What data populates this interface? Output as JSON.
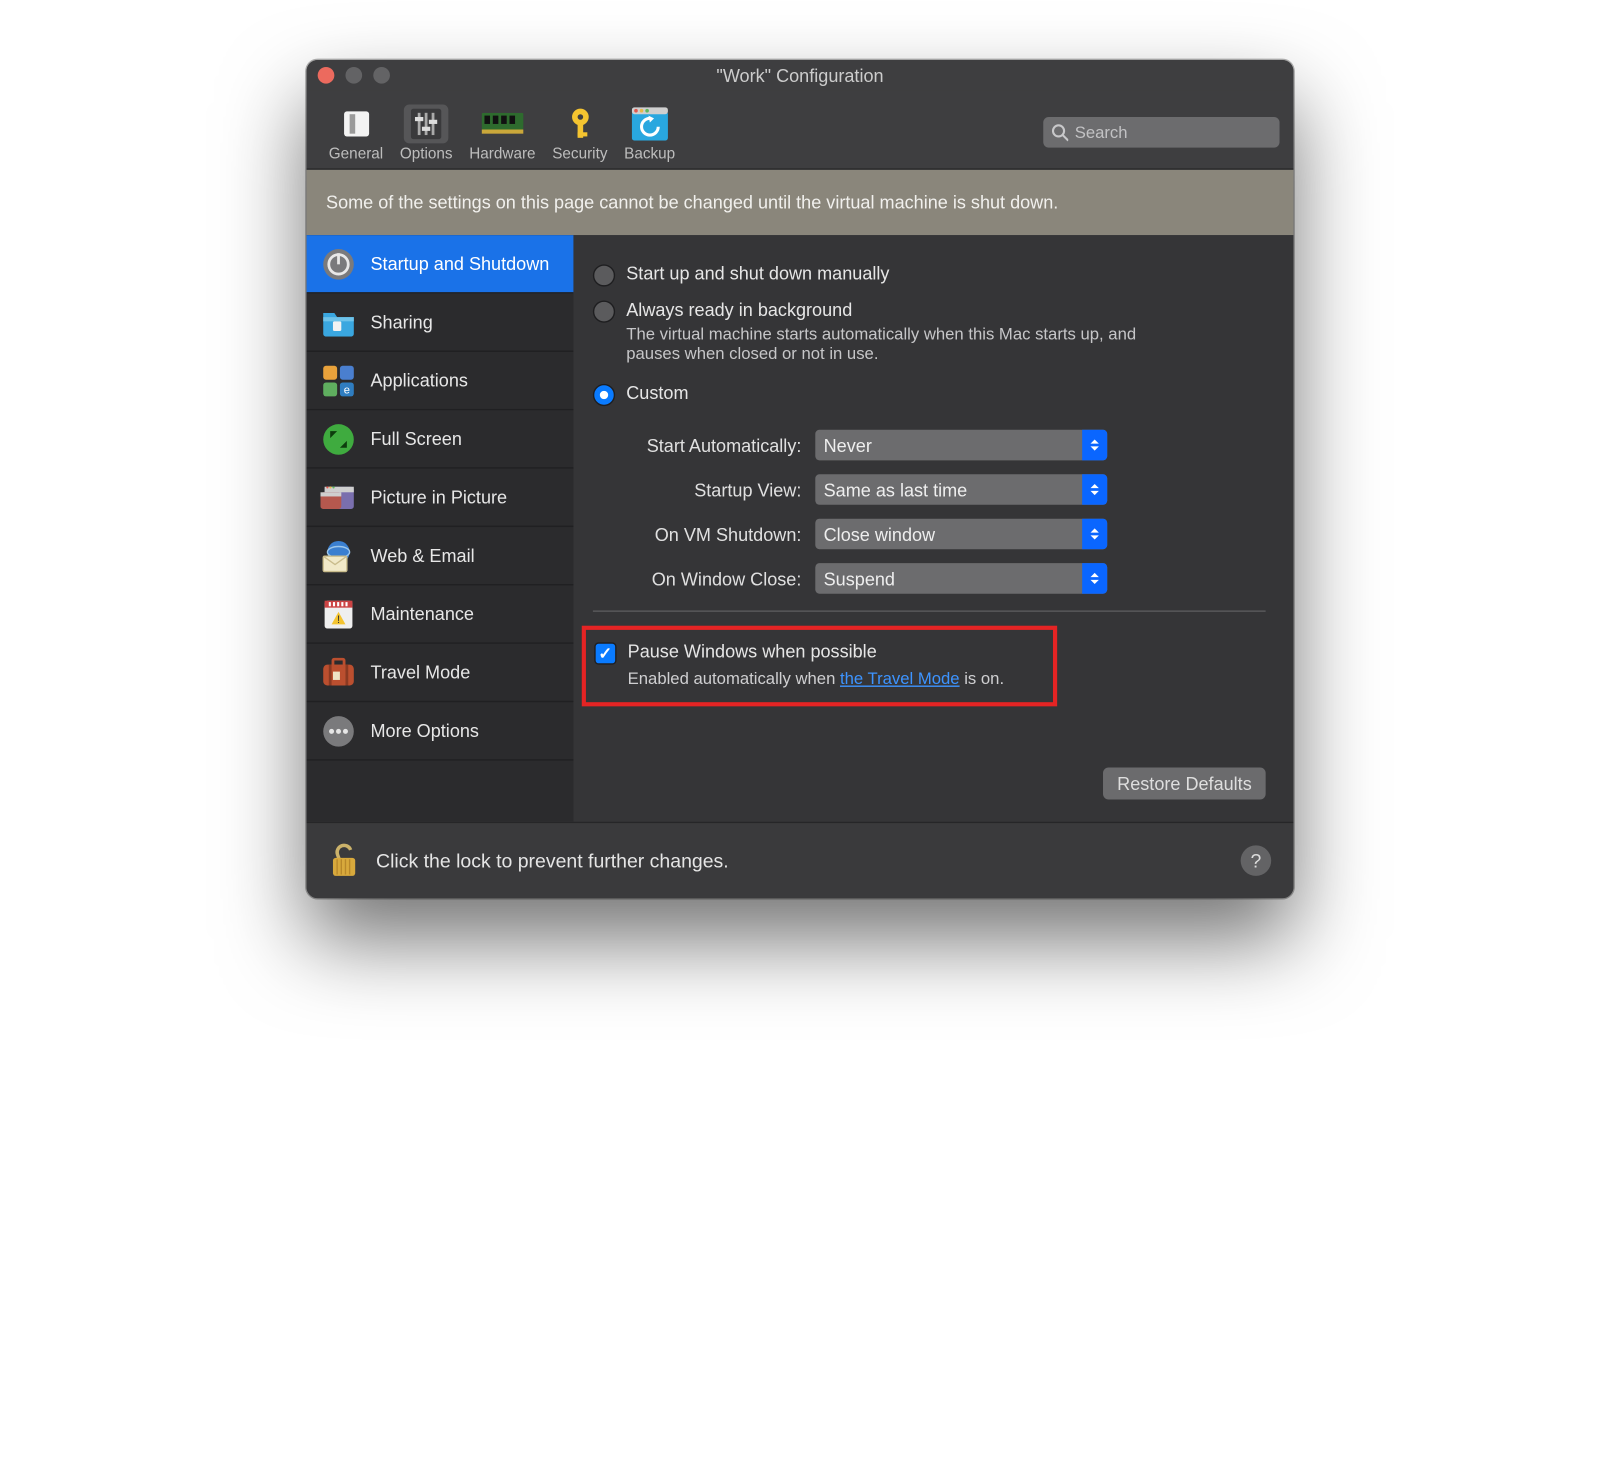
{
  "window": {
    "title": "\"Work\" Configuration"
  },
  "toolbar": {
    "items": [
      {
        "label": "General"
      },
      {
        "label": "Options"
      },
      {
        "label": "Hardware"
      },
      {
        "label": "Security"
      },
      {
        "label": "Backup"
      }
    ],
    "search_placeholder": "Search"
  },
  "warning": "Some of the settings on this page cannot be changed until the virtual machine is shut down.",
  "sidebar": {
    "items": [
      {
        "label": "Startup and Shutdown"
      },
      {
        "label": "Sharing"
      },
      {
        "label": "Applications"
      },
      {
        "label": "Full Screen"
      },
      {
        "label": "Picture in Picture"
      },
      {
        "label": "Web & Email"
      },
      {
        "label": "Maintenance"
      },
      {
        "label": "Travel Mode"
      },
      {
        "label": "More Options"
      }
    ]
  },
  "radios": {
    "manual": "Start up and shut down manually",
    "ready": "Always ready in background",
    "ready_desc": "The virtual machine starts automatically when this Mac starts up, and pauses when closed or not in use.",
    "custom": "Custom"
  },
  "form": {
    "start_auto_label": "Start Automatically:",
    "start_auto_value": "Never",
    "startup_view_label": "Startup View:",
    "startup_view_value": "Same as last time",
    "vm_shutdown_label": "On VM Shutdown:",
    "vm_shutdown_value": "Close window",
    "window_close_label": "On Window Close:",
    "window_close_value": "Suspend"
  },
  "pause": {
    "label": "Pause Windows when possible",
    "desc_pre": "Enabled automatically when ",
    "desc_link": "the Travel Mode",
    "desc_post": " is on."
  },
  "restore_label": "Restore Defaults",
  "footer": {
    "lock_text": "Click the lock to prevent further changes.",
    "help": "?"
  }
}
